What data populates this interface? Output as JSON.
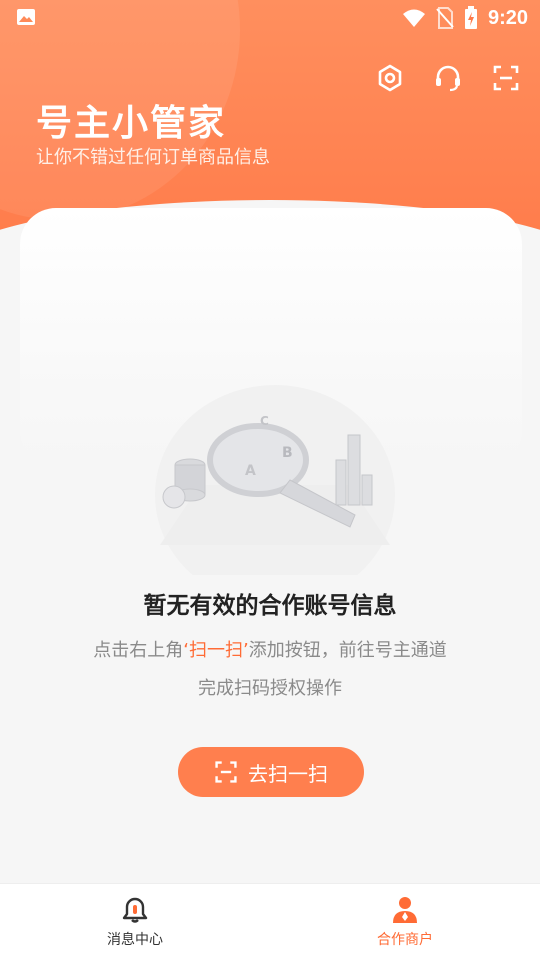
{
  "status_bar": {
    "time": "9:20"
  },
  "header": {
    "title": "号主小管家",
    "subtitle": "让你不错过任何订单商品信息",
    "icons": [
      "settings-icon",
      "headset-icon",
      "scan-icon"
    ]
  },
  "empty_state": {
    "title": "暂无有效的合作账号信息",
    "desc_before": "点击右上角",
    "desc_highlight": "‘扫一扫’",
    "desc_after": "添加按钮，前往号主通道",
    "desc_line2": "完成扫码授权操作",
    "button_label": "去扫一扫"
  },
  "tabbar": {
    "items": [
      {
        "label": "消息中心",
        "icon": "bell-icon",
        "active": false
      },
      {
        "label": "合作商户",
        "icon": "merchant-icon",
        "active": true
      }
    ]
  },
  "colors": {
    "accent": "#ff7a49",
    "highlight": "#ff6b35"
  }
}
